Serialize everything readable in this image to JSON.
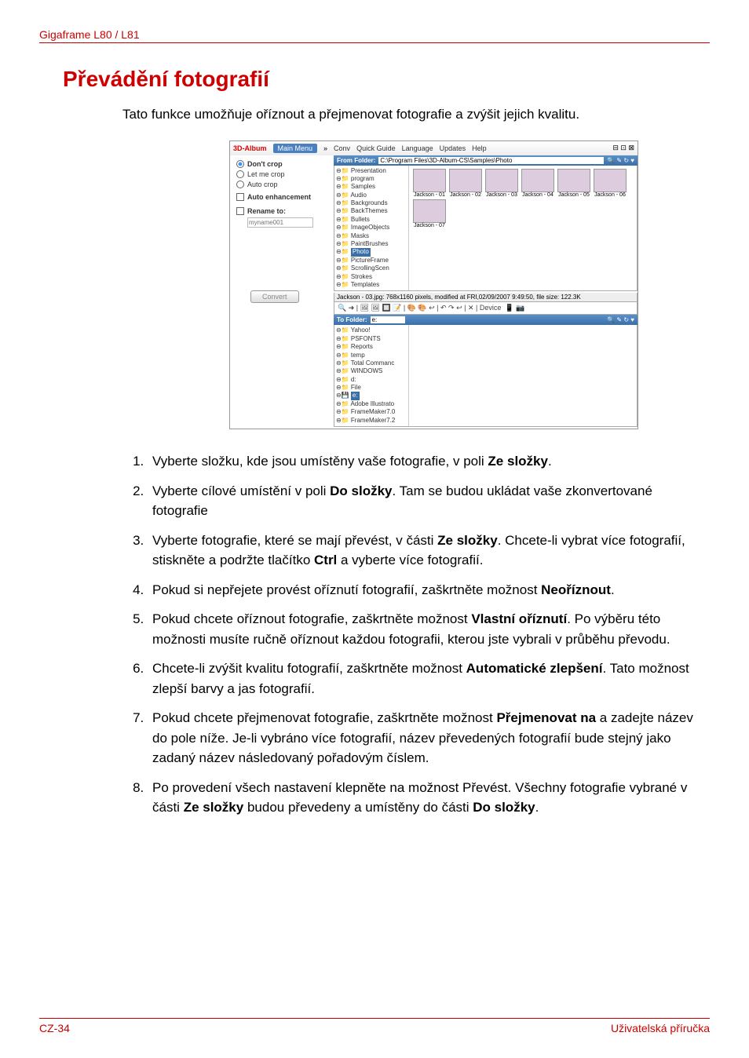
{
  "header": "Gigaframe L80 / L81",
  "title": "Převádění fotografií",
  "intro": "Tato funkce umožňuje oříznout a přejmenovat fotografie a zvýšit jejich kvalitu.",
  "shot": {
    "brand": "3D-Album",
    "menu": {
      "main": "Main Menu",
      "conv": "Conv",
      "quick": "Quick Guide",
      "lang": "Language",
      "upd": "Updates",
      "help": "Help"
    },
    "left": {
      "dont": "Don't crop",
      "let": "Let me crop",
      "auto": "Auto crop",
      "enh": "Auto enhancement",
      "ren": "Rename to:",
      "ph": "myname001",
      "convert": "Convert"
    },
    "from": {
      "label": "From Folder:",
      "path": "C:\\Program Files\\3D-Album-CS\\Samples\\Photo",
      "tree": [
        "Presentation",
        "program",
        "Samples",
        "Audio",
        "Backgrounds",
        "BackThemes",
        "Bullets",
        "ImageObjects",
        "Masks",
        "PaintBrushes",
        "Photo",
        "PictureFrame",
        "ScrollingScen",
        "Strokes",
        "Templates"
      ],
      "sel": "Photo",
      "thumbs": [
        "Jackson - 01",
        "Jackson - 02",
        "Jackson - 03",
        "Jackson - 04",
        "Jackson - 05",
        "Jackson - 06",
        "Jackson - 07"
      ]
    },
    "status": "Jackson - 03.jpg: 768x1160 pixels, modified at FRI,02/09/2007 9:49:50, file size: 122.3K",
    "tool": "Device",
    "to": {
      "label": "To Folder:",
      "path": "e:",
      "tree": [
        "Yahoo!",
        "PSFONTS",
        "Reports",
        "temp",
        "Total Commanc",
        "WINDOWS",
        "d:",
        "File",
        "e:",
        "Adobe Illustrato",
        "FrameMaker7.0",
        "FrameMaker7.2"
      ],
      "sel": "e:"
    }
  },
  "steps": {
    "s1a": "Vyberte složku, kde jsou umístěny vaše fotografie, v poli ",
    "s1b": "Ze složky",
    "s1c": ".",
    "s2a": "Vyberte cílové umístění v poli ",
    "s2b": "Do složky",
    "s2c": ". Tam se budou ukládat vaše zkonvertované fotografie",
    "s3a": "Vyberte fotografie, které se mají převést, v části ",
    "s3b": "Ze složky",
    "s3c": ". Chcete-li vybrat více fotografií, stiskněte a podržte tlačítko ",
    "s3d": "Ctrl",
    "s3e": " a vyberte více fotografií.",
    "s4a": "Pokud si nepřejete provést oříznutí fotografií, zaškrtněte možnost ",
    "s4b": "Neoříznout",
    "s4c": ".",
    "s5a": "Pokud chcete oříznout fotografie, zaškrtněte možnost ",
    "s5b": "Vlastní oříznutí",
    "s5c": ". Po výběru této možnosti musíte ručně oříznout každou fotografii, kterou jste vybrali v průběhu převodu.",
    "s6a": "Chcete-li zvýšit kvalitu fotografií, zaškrtněte možnost ",
    "s6b": "Automatické zlepšení",
    "s6c": ". Tato možnost zlepší barvy a jas fotografií.",
    "s7a": "Pokud chcete přejmenovat fotografie, zaškrtněte možnost ",
    "s7b": "Přejmenovat na",
    "s7c": " a zadejte název do pole níže. Je-li vybráno více fotografií, název převedených fotografií bude stejný jako zadaný název následovaný pořadovým číslem.",
    "s8a": "Po provedení všech nastavení klepněte na možnost Převést. Všechny fotografie vybrané v části ",
    "s8b": "Ze složky",
    "s8c": " budou převedeny a umístěny do části ",
    "s8d": "Do složky",
    "s8e": "."
  },
  "footer": {
    "left": "CZ-34",
    "right": "Uživatelská příručka"
  }
}
